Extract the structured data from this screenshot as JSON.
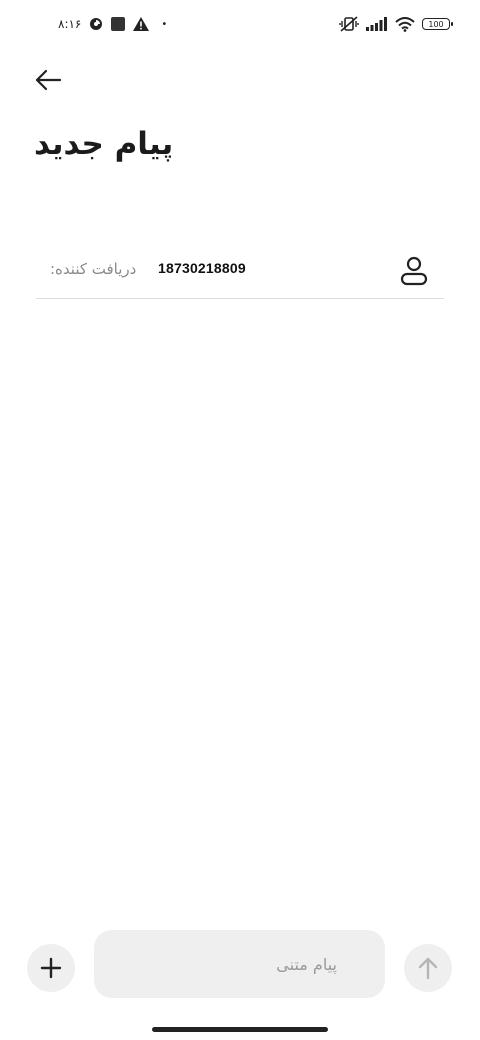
{
  "status_bar": {
    "time": "۸:۱۶",
    "battery": "100",
    "dot": "•"
  },
  "header": {
    "title": "پیام جدید"
  },
  "recipient": {
    "label": "دریافت کننده:",
    "number": "18730218809"
  },
  "composer": {
    "placeholder": "پیام متنی"
  },
  "colors": {
    "background": "#ffffff",
    "input_background": "#efefef",
    "text_primary": "#1b1b1b",
    "text_secondary": "#8a8a8a",
    "divider": "#dcdcdc"
  }
}
